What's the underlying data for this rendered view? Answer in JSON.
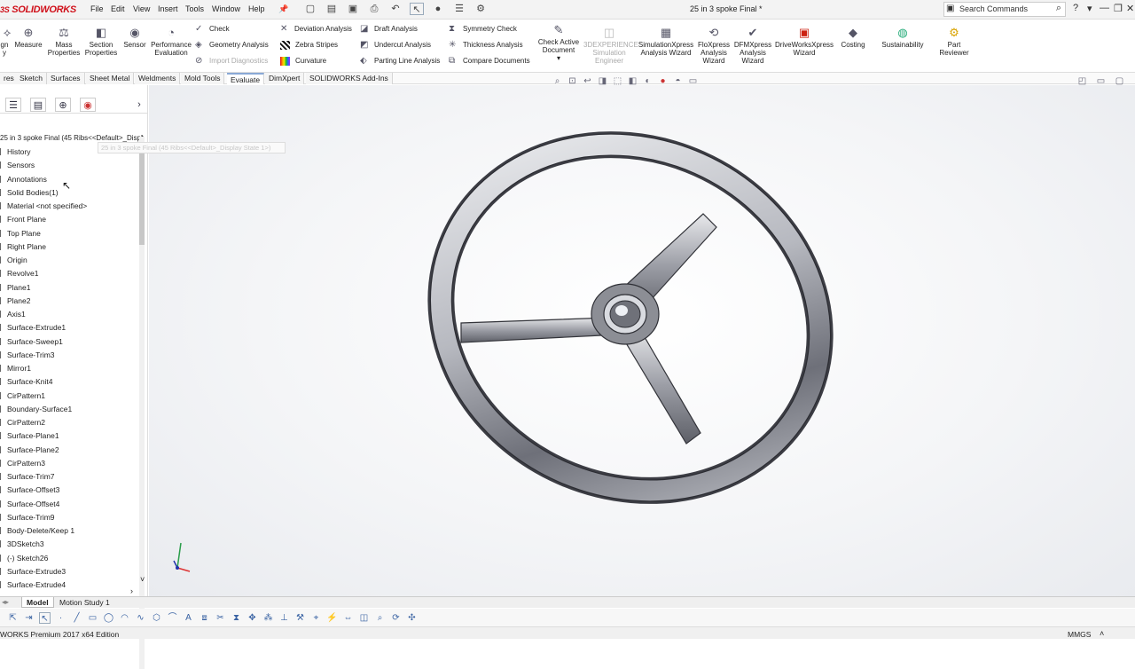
{
  "app": {
    "logo": "SOLIDWORKS",
    "logo_prefix": "3S"
  },
  "menu": [
    "File",
    "Edit",
    "View",
    "Insert",
    "Tools",
    "Window",
    "Help"
  ],
  "document_title": "25 in 3 spoke Final *",
  "search": {
    "placeholder": "Search Commands"
  },
  "ribbon": {
    "big_buttons": [
      {
        "label": "gn\ny",
        "icon": "design-icon"
      },
      {
        "label": "Measure",
        "icon": "measure-icon"
      },
      {
        "label": "Mass\nProperties",
        "icon": "mass-properties-icon"
      },
      {
        "label": "Section\nProperties",
        "icon": "section-properties-icon"
      },
      {
        "label": "Sensor",
        "icon": "sensor-icon"
      },
      {
        "label": "Performance\nEvaluation",
        "icon": "performance-icon"
      }
    ],
    "col1": [
      {
        "label": "Check",
        "icon": "check-icon",
        "enabled": true
      },
      {
        "label": "Geometry Analysis",
        "icon": "geometry-analysis-icon",
        "enabled": true
      },
      {
        "label": "Import Diagnostics",
        "icon": "import-diagnostics-icon",
        "enabled": false
      }
    ],
    "col2": [
      {
        "label": "Deviation Analysis",
        "icon": "deviation-icon"
      },
      {
        "label": "Zebra Stripes",
        "icon": "zebra-icon"
      },
      {
        "label": "Curvature",
        "icon": "curvature-icon"
      }
    ],
    "col3": [
      {
        "label": "Draft Analysis",
        "icon": "draft-icon"
      },
      {
        "label": "Undercut Analysis",
        "icon": "undercut-icon"
      },
      {
        "label": "Parting Line Analysis",
        "icon": "parting-line-icon"
      }
    ],
    "col4": [
      {
        "label": "Symmetry Check",
        "icon": "symmetry-icon"
      },
      {
        "label": "Thickness Analysis",
        "icon": "thickness-icon"
      },
      {
        "label": "Compare Documents",
        "icon": "compare-icon"
      }
    ],
    "right_buttons": [
      {
        "label": "Check Active\nDocument",
        "icon": "check-active-icon",
        "enabled": true
      },
      {
        "label": "3DEXPERIENCE\nSimulation\nEngineer",
        "icon": "3dx-icon",
        "enabled": false
      },
      {
        "label": "SimulationXpress\nAnalysis Wizard",
        "icon": "simxpress-icon",
        "enabled": true
      },
      {
        "label": "FloXpress\nAnalysis\nWizard",
        "icon": "floxpress-icon",
        "enabled": true
      },
      {
        "label": "DFMXpress\nAnalysis\nWizard",
        "icon": "dfmxpress-icon",
        "enabled": true
      },
      {
        "label": "DriveWorksXpress\nWizard",
        "icon": "driveworks-icon",
        "enabled": true
      },
      {
        "label": "Costing",
        "icon": "costing-icon",
        "enabled": true
      },
      {
        "label": "Sustainability",
        "icon": "sustainability-icon",
        "enabled": true
      },
      {
        "label": "Part\nReviewer",
        "icon": "part-reviewer-icon",
        "enabled": true
      }
    ]
  },
  "command_tabs": [
    "res",
    "Sketch",
    "Surfaces",
    "Sheet Metal",
    "Weldments",
    "Mold Tools",
    "Evaluate",
    "DimXpert",
    "SOLIDWORKS Add-Ins"
  ],
  "active_tab": "Evaluate",
  "tree": {
    "header": "25 in 3 spoke Final  (45 Ribs<<Default>_Displ",
    "tooltip": "25 in 3 spoke Final  (45 Ribs<<Default>_Display State 1>)",
    "items": [
      "History",
      "Sensors",
      "Annotations",
      "Solid Bodies(1)",
      "Material <not specified>",
      "Front Plane",
      "Top Plane",
      "Right Plane",
      "Origin",
      "Revolve1",
      "Plane1",
      "Plane2",
      "Axis1",
      "Surface-Extrude1",
      "Surface-Sweep1",
      "Surface-Trim3",
      "Mirror1",
      "Surface-Knit4",
      "CirPattern1",
      "Boundary-Surface1",
      "CirPattern2",
      "Surface-Plane1",
      "Surface-Plane2",
      "CirPattern3",
      "Surface-Trim7",
      "Surface-Offset3",
      "Surface-Offset4",
      "Surface-Trim9",
      "Body-Delete/Keep 1",
      "3DSketch3",
      "(-) Sketch26",
      "Surface-Extrude3",
      "Surface-Extrude4"
    ]
  },
  "bottom_tabs": [
    "Model",
    "Motion Study 1"
  ],
  "status": {
    "edition": "WORKS Premium 2017 x64 Edition",
    "units": "MMGS"
  }
}
